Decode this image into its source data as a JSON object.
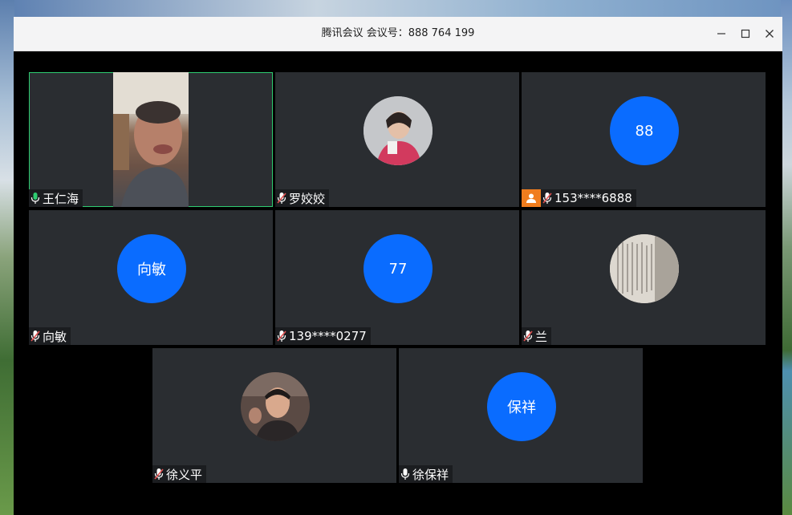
{
  "window": {
    "title": "腾讯会议 会议号：888 764 199"
  },
  "participants": [
    {
      "name": "王仁海",
      "avatar_type": "video",
      "mic": "on",
      "active_speaker": true
    },
    {
      "name": "罗姣姣",
      "avatar_type": "photo",
      "mic": "muted"
    },
    {
      "name": "153****6888",
      "avatar_type": "text",
      "avatar_text": "88",
      "mic": "muted",
      "host_badge": true
    },
    {
      "name": "向敏",
      "avatar_type": "text",
      "avatar_text": "向敏",
      "mic": "muted"
    },
    {
      "name": "139****0277",
      "avatar_type": "text",
      "avatar_text": "77",
      "mic": "muted"
    },
    {
      "name": "兰",
      "avatar_type": "photo",
      "mic": "muted"
    },
    {
      "name": "徐义平",
      "avatar_type": "photo",
      "mic": "muted"
    },
    {
      "name": "徐保祥",
      "avatar_type": "text",
      "avatar_text": "保祥",
      "mic": "on-white"
    }
  ],
  "colors": {
    "tile_bg": "#2a2d31",
    "avatar_blue": "#0a6cff",
    "active_border": "#2ecc71",
    "host_badge": "#f07d1e",
    "mic_on": "#2ecc71",
    "mic_muted": "#e05050"
  }
}
